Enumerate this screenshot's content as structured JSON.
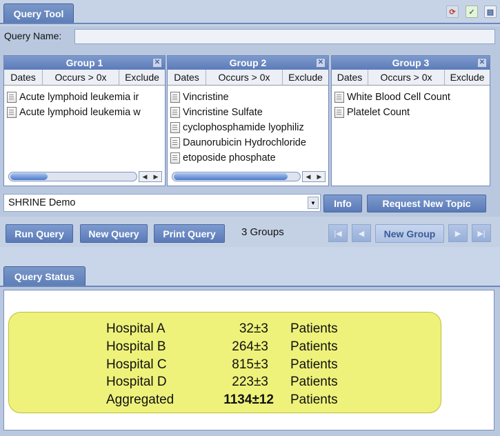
{
  "header": {
    "tab_label": "Query Tool"
  },
  "query_name": {
    "label": "Query Name:",
    "value": ""
  },
  "groups": [
    {
      "title": "Group 1",
      "columns": [
        "Dates",
        "Occurs > 0x",
        "Exclude"
      ],
      "items": [
        "Acute lymphoid leukemia ir",
        "Acute lymphoid leukemia w"
      ]
    },
    {
      "title": "Group 2",
      "columns": [
        "Dates",
        "Occurs > 0x",
        "Exclude"
      ],
      "items": [
        "Vincristine",
        "Vincristine Sulfate",
        "cyclophosphamide lyophiliz",
        "Daunorubicin Hydrochloride",
        "etoposide phosphate"
      ]
    },
    {
      "title": "Group 3",
      "columns": [
        "Dates",
        "Occurs > 0x",
        "Exclude"
      ],
      "items": [
        "White Blood Cell Count",
        "Platelet Count"
      ]
    }
  ],
  "topic": {
    "selected": "SHRINE Demo",
    "info_label": "Info",
    "request_label": "Request New Topic"
  },
  "actions": {
    "run": "Run Query",
    "new": "New Query",
    "print": "Print Query",
    "group_count": "3 Groups",
    "new_group": "New Group"
  },
  "status": {
    "tab_label": "Query Status",
    "rows": [
      {
        "site": "Hospital A",
        "count": "32±3",
        "unit": "Patients"
      },
      {
        "site": "Hospital B",
        "count": "264±3",
        "unit": "Patients"
      },
      {
        "site": "Hospital C",
        "count": "815±3",
        "unit": "Patients"
      },
      {
        "site": "Hospital D",
        "count": "223±3",
        "unit": "Patients"
      },
      {
        "site": "Aggregated",
        "count": "1134±12",
        "unit": "Patients"
      }
    ]
  },
  "colors": {
    "accent": "#5c7db7",
    "result_bg": "#eef27a",
    "page_bg": "#b9c8de"
  }
}
